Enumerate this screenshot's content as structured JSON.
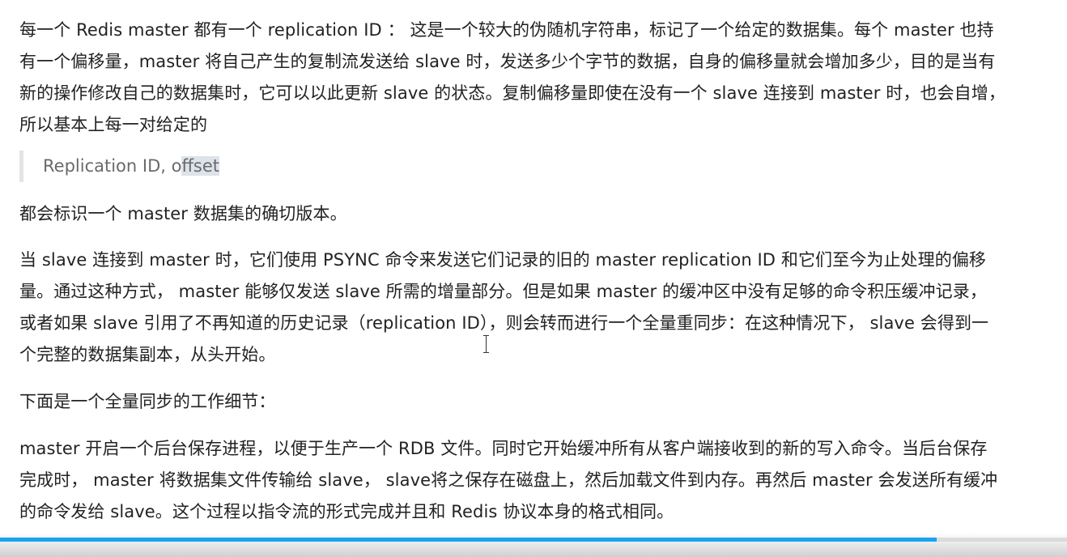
{
  "paragraphs": {
    "p1": "每一个 Redis master 都有一个 replication ID ： 这是一个较大的伪随机字符串，标记了一个给定的数据集。每个 master 也持有一个偏移量，master 将自己产生的复制流发送给 slave 时，发送多少个字节的数据，自身的偏移量就会增加多少，目的是当有新的操作修改自己的数据集时，它可以以此更新 slave 的状态。复制偏移量即使在没有一个 slave 连接到 master 时，也会自增，所以基本上每一对给定的",
    "quote_pre": "Replication ID, o",
    "quote_hl": "ffset",
    "p2": "都会标识一个 master 数据集的确切版本。",
    "p3": "当 slave 连接到 master 时，它们使用 PSYNC 命令来发送它们记录的旧的 master replication ID 和它们至今为止处理的偏移量。通过这种方式， master 能够仅发送 slave 所需的增量部分。但是如果 master 的缓冲区中没有足够的命令积压缓冲记录，或者如果 slave 引用了不再知道的历史记录（replication ID），则会转而进行一个全量重同步：在这种情况下， slave 会得到一个完整的数据集副本，从头开始。",
    "p4": "下面是一个全量同步的工作细节：",
    "p5": "master 开启一个后台保存进程，以便于生产一个 RDB 文件。同时它开始缓冲所有从客户端接收到的新的写入命令。当后台保存完成时， master 将数据集文件传输给 slave， slave将之保存在磁盘上，然后加载文件到内存。再然后 master 会发送所有缓冲的命令发给 slave。这个过程以指令流的形式完成并且和 Redis 协议本身的格式相同。"
  },
  "video_progress": {
    "fraction": 0.878,
    "color": "#1aa3f0"
  },
  "cursor_icon": "text-cursor-ibeam"
}
